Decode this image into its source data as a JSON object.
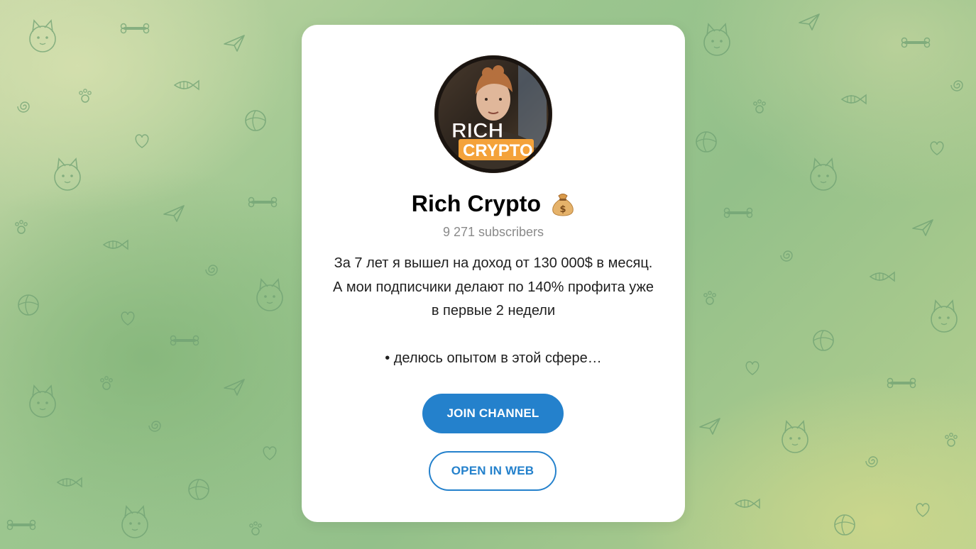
{
  "channel": {
    "avatar_text_line1": "RICH",
    "avatar_text_line2": "CRYPTO",
    "title": "Rich Crypto",
    "title_emoji": "moneybag-icon",
    "subscribers": "9 271 subscribers",
    "description_lines": [
      "За 7 лет я вышел на доход от 130 000$ в месяц.",
      "А мои подписчики делают по 140% профита уже",
      "в первые 2 недели",
      "• делюсь опытом в этой сфере…"
    ]
  },
  "actions": {
    "join_label": "JOIN CHANNEL",
    "open_web_label": "OPEN IN WEB"
  },
  "colors": {
    "accent": "#2481cc",
    "background_green": "#9cc68f",
    "card": "#ffffff",
    "muted_text": "#8a8a8a"
  }
}
